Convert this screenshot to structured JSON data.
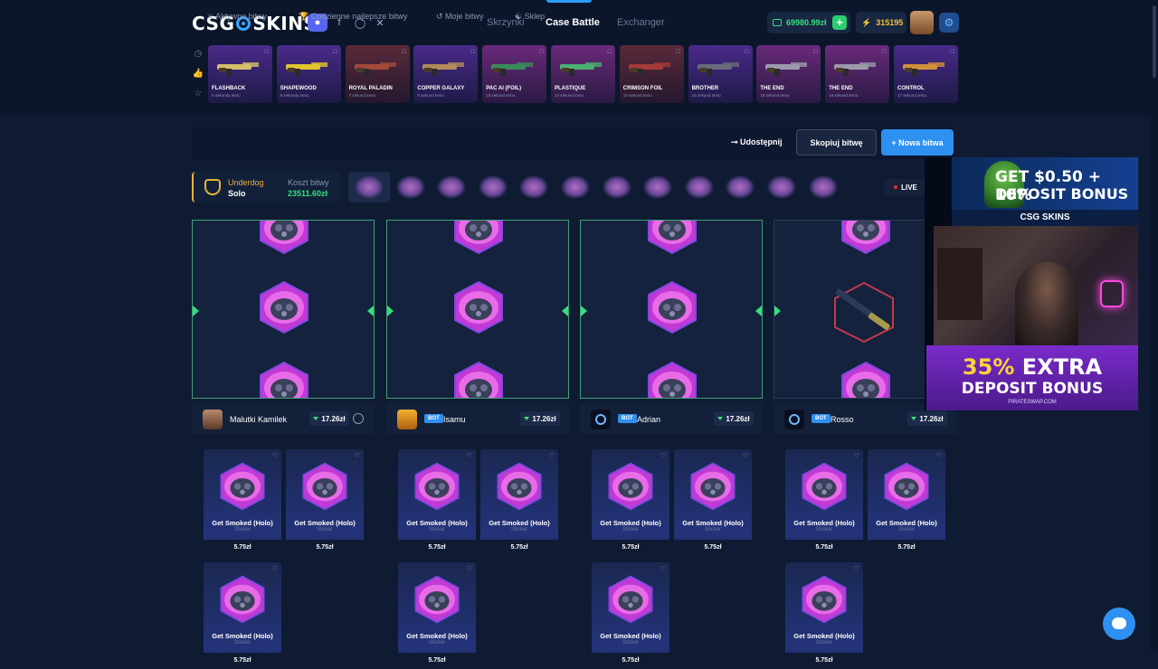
{
  "brand": {
    "logo_left": "CSG",
    "logo_right": "SKINS"
  },
  "nav": {
    "links": [
      {
        "label": "Skrzynki"
      },
      {
        "label": "Case Battle"
      },
      {
        "label": "Exchanger"
      }
    ],
    "active": "Case Battle"
  },
  "account": {
    "balance": "69980.99zł",
    "points": "315195"
  },
  "drops": [
    {
      "name": "FLASHBACK",
      "sub": "8 sekundy temu",
      "color": "violet"
    },
    {
      "name": "SHAPEWOOD",
      "sub": "8 sekundy temu",
      "color": "violet"
    },
    {
      "name": "ROYAL PALADIN",
      "sub": "7 sekund temu",
      "color": "red"
    },
    {
      "name": "COPPER GALAXY",
      "sub": "9 sekund temu",
      "color": "violet"
    },
    {
      "name": "PAC AI (FOIL)",
      "sub": "10 sekund temu",
      "color": "pink"
    },
    {
      "name": "PLASTIQUE",
      "sub": "10 sekund temu",
      "color": "pink"
    },
    {
      "name": "CRIMSON FOIL",
      "sub": "10 sekund temu",
      "color": "red"
    },
    {
      "name": "BROTHER",
      "sub": "16 sekund temu",
      "color": "violet"
    },
    {
      "name": "THE END",
      "sub": "16 sekund temu",
      "color": "pink"
    },
    {
      "name": "THE END",
      "sub": "16 sekund temu",
      "color": "pink"
    },
    {
      "name": "CONTROL",
      "sub": "17 sekund temu",
      "color": "violet"
    }
  ],
  "filters": {
    "active": "Aktywne bitwy",
    "best": "Codzienne najlepsze bitwy",
    "mine": "Moje bitwy",
    "shop": "Sklep",
    "share": "Udostępnij",
    "copy": "Skopiuj bitwę",
    "new": "+ Nowa bitwa"
  },
  "battle": {
    "mode": "Underdog",
    "type": "Solo",
    "cost_label": "Koszt bitwy",
    "cost": "23511.60zł",
    "live": "LIVE"
  },
  "players": [
    {
      "name": "Malutki Kamilek",
      "bot": false,
      "value": "17.26zł"
    },
    {
      "name": "Isamu",
      "bot": true,
      "value": "17.26zł"
    },
    {
      "name": "Adrian",
      "bot": true,
      "value": "17.26zł"
    },
    {
      "name": "Rosso",
      "bot": true,
      "value": "17.26zł"
    }
  ],
  "bot_label": "BOT",
  "item": {
    "name": "Get Smoked (Holo)",
    "type": "Sticker",
    "price": "5.75zł"
  },
  "ad": {
    "line1": "GET $0.50 + 10%",
    "line2": "DEPOSIT BONUS",
    "brand": "CSG SKINS",
    "extra_pct": "35%",
    "extra_word": "EXTRA",
    "bonus": "DEPOSIT BONUS",
    "site": "PIRATESWAP.COM"
  },
  "colors": {
    "accent": "#2e90f0",
    "positive": "#35e07a",
    "gold": "#e7b43a"
  }
}
